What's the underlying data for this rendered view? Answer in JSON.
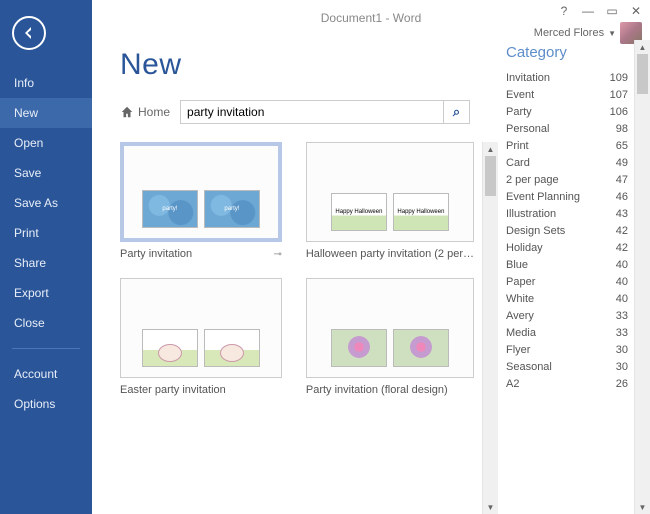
{
  "window": {
    "title": "Document1 - Word",
    "user_name": "Merced Flores"
  },
  "sidebar": {
    "items": [
      "Info",
      "New",
      "Open",
      "Save",
      "Save As",
      "Print",
      "Share",
      "Export",
      "Close"
    ],
    "selected_index": 1,
    "footer_items": [
      "Account",
      "Options"
    ]
  },
  "page": {
    "title": "New",
    "home_label": "Home"
  },
  "search": {
    "value": "party invitation",
    "placeholder": ""
  },
  "templates": [
    {
      "label": "Party invitation",
      "selected": true,
      "theme": "tpl1",
      "card_text": "party!"
    },
    {
      "label": "Halloween party invitation (2 per…",
      "selected": false,
      "theme": "tpl2",
      "card_text": "Happy Halloween"
    },
    {
      "label": "Easter party invitation",
      "selected": false,
      "theme": "tpl3",
      "card_text": ""
    },
    {
      "label": "Party invitation (floral design)",
      "selected": false,
      "theme": "tpl4",
      "card_text": ""
    }
  ],
  "categories": {
    "title": "Category",
    "items": [
      {
        "name": "Invitation",
        "count": 109
      },
      {
        "name": "Event",
        "count": 107
      },
      {
        "name": "Party",
        "count": 106
      },
      {
        "name": "Personal",
        "count": 98
      },
      {
        "name": "Print",
        "count": 65
      },
      {
        "name": "Card",
        "count": 49
      },
      {
        "name": "2 per page",
        "count": 47
      },
      {
        "name": "Event Planning",
        "count": 46
      },
      {
        "name": "Illustration",
        "count": 43
      },
      {
        "name": "Design Sets",
        "count": 42
      },
      {
        "name": "Holiday",
        "count": 42
      },
      {
        "name": "Blue",
        "count": 40
      },
      {
        "name": "Paper",
        "count": 40
      },
      {
        "name": "White",
        "count": 40
      },
      {
        "name": "Avery",
        "count": 33
      },
      {
        "name": "Media",
        "count": 33
      },
      {
        "name": "Flyer",
        "count": 30
      },
      {
        "name": "Seasonal",
        "count": 30
      },
      {
        "name": "A2",
        "count": 26
      }
    ]
  }
}
